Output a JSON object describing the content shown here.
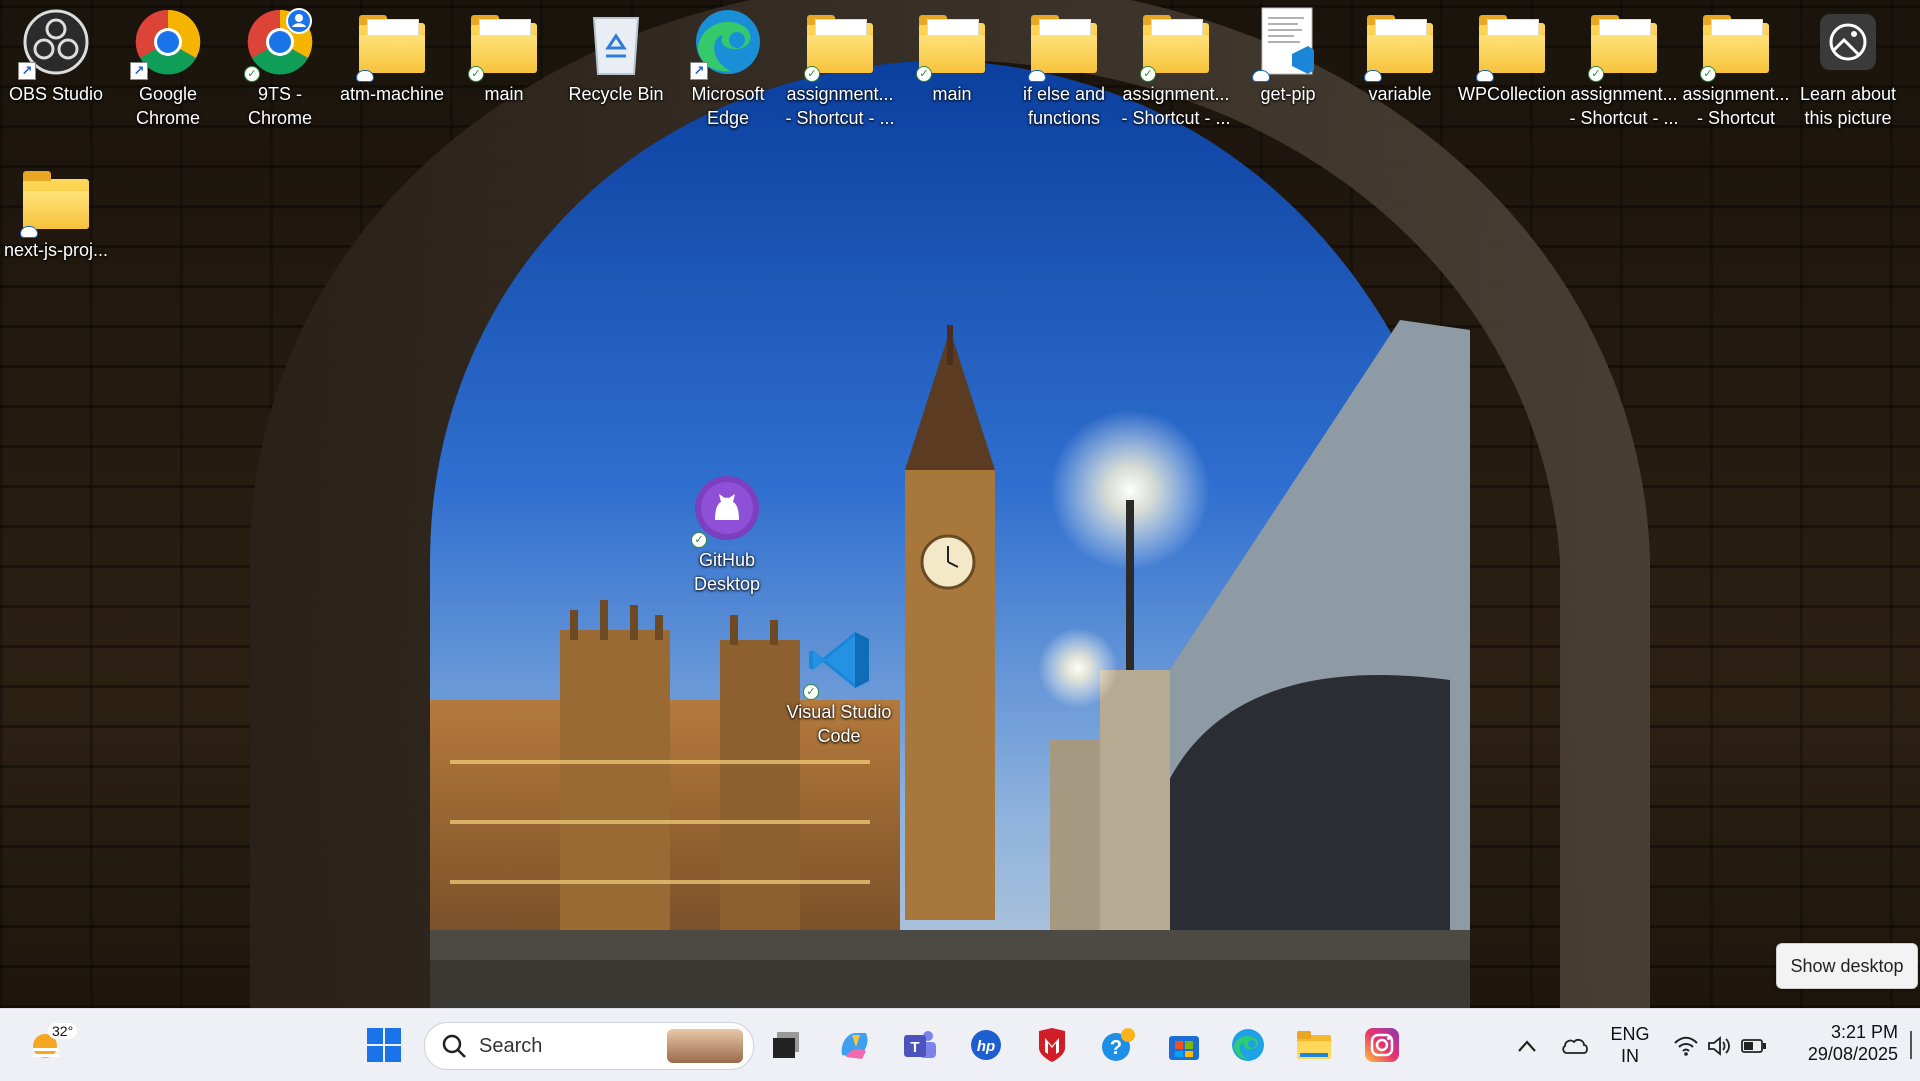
{
  "desktop": {
    "icons_top_row": [
      {
        "label": "OBS Studio",
        "icon": "obs-icon",
        "badge": "shortcut"
      },
      {
        "label": "Google Chrome",
        "icon": "chrome-icon",
        "badge": "shortcut"
      },
      {
        "label": "9TS - Chrome",
        "icon": "chrome-profile-icon",
        "badge": "synced"
      },
      {
        "label": "atm-machine",
        "icon": "folder-icon",
        "badge": "cloud"
      },
      {
        "label": "main",
        "icon": "folder-icon",
        "badge": "synced"
      },
      {
        "label": "Recycle Bin",
        "icon": "recycle-bin-icon",
        "badge": ""
      },
      {
        "label": "Microsoft Edge",
        "icon": "edge-icon",
        "badge": "shortcut"
      },
      {
        "label": "assignment... - Shortcut - ...",
        "icon": "folder-icon",
        "badge": "synced"
      },
      {
        "label": "main",
        "icon": "folder-icon",
        "badge": "synced"
      },
      {
        "label": "if else and functions",
        "icon": "folder-icon",
        "badge": "cloud"
      },
      {
        "label": "assignment... - Shortcut - ...",
        "icon": "folder-icon",
        "badge": "synced"
      },
      {
        "label": "get-pip",
        "icon": "python-file-icon",
        "badge": "cloud"
      },
      {
        "label": "variable",
        "icon": "folder-icon",
        "badge": "cloud"
      },
      {
        "label": "WPCollection",
        "icon": "folder-icon",
        "badge": "cloud"
      },
      {
        "label": "assignment... - Shortcut - ...",
        "icon": "folder-icon",
        "badge": "synced"
      },
      {
        "label": "assignment... - Shortcut",
        "icon": "folder-icon",
        "badge": "synced"
      },
      {
        "label": "Learn about this picture",
        "icon": "spotlight-icon",
        "badge": ""
      }
    ],
    "icon_next": {
      "label": "next-js-proj...",
      "icon": "folder-icon",
      "badge": "cloud"
    },
    "icon_github": {
      "label": "GitHub Desktop",
      "icon": "github-desktop-icon"
    },
    "icon_vscode": {
      "label": "Visual Studio Code",
      "icon": "vscode-icon"
    }
  },
  "tooltip": {
    "text": "Show desktop"
  },
  "taskbar": {
    "weather": {
      "temp": "32°",
      "icon": "weather-sun-icon"
    },
    "search_placeholder": "Search",
    "apps": [
      {
        "name": "start-button",
        "icon": "windows-logo-icon"
      },
      {
        "name": "task-view",
        "icon": "task-view-icon"
      },
      {
        "name": "copilot",
        "icon": "copilot-icon"
      },
      {
        "name": "teams",
        "icon": "teams-icon"
      },
      {
        "name": "hp",
        "icon": "hp-icon"
      },
      {
        "name": "mcafee",
        "icon": "mcafee-icon"
      },
      {
        "name": "get-help",
        "icon": "get-help-icon"
      },
      {
        "name": "microsoft-store",
        "icon": "store-icon"
      },
      {
        "name": "edge",
        "icon": "edge-icon"
      },
      {
        "name": "file-explorer",
        "icon": "folder-icon"
      },
      {
        "name": "instagram",
        "icon": "instagram-icon"
      }
    ],
    "tray": {
      "lang_top": "ENG",
      "lang_bottom": "IN",
      "time": "3:21 PM",
      "date": "29/08/2025"
    }
  }
}
